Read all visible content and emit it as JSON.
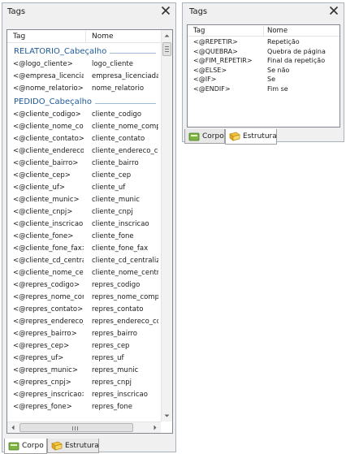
{
  "left_panel": {
    "title": "Tags",
    "columns": {
      "tag": "Tag",
      "nome": "Nome"
    },
    "groups": [
      {
        "label": "RELATORIO_Cabeçalho",
        "rows": [
          {
            "tag": "<@logo_cliente>",
            "nome": "logo_cliente"
          },
          {
            "tag": "<@empresa_licenciada>",
            "nome": "empresa_licenciada"
          },
          {
            "tag": "<@nome_relatorio>",
            "nome": "nome_relatorio"
          }
        ]
      },
      {
        "label": "PEDIDO_Cabeçalho",
        "rows": [
          {
            "tag": "<@cliente_codigo>",
            "nome": "cliente_codigo"
          },
          {
            "tag": "<@cliente_nome_completo>",
            "nome": "cliente_nome_completo"
          },
          {
            "tag": "<@cliente_contato>",
            "nome": "cliente_contato"
          },
          {
            "tag": "<@cliente_endereco_completo>",
            "nome": "cliente_endereco_completo"
          },
          {
            "tag": "<@cliente_bairro>",
            "nome": "cliente_bairro"
          },
          {
            "tag": "<@cliente_cep>",
            "nome": "cliente_cep"
          },
          {
            "tag": "<@cliente_uf>",
            "nome": "cliente_uf"
          },
          {
            "tag": "<@cliente_munic>",
            "nome": "cliente_munic"
          },
          {
            "tag": "<@cliente_cnpj>",
            "nome": "cliente_cnpj"
          },
          {
            "tag": "<@cliente_inscricao>",
            "nome": "cliente_inscricao"
          },
          {
            "tag": "<@cliente_fone>",
            "nome": "cliente_fone"
          },
          {
            "tag": "<@cliente_fone_fax>",
            "nome": "cliente_fone_fax"
          },
          {
            "tag": "<@cliente_cd_centralizador>",
            "nome": "cliente_cd_centralizador"
          },
          {
            "tag": "<@cliente_nome_centralizador>",
            "nome": "cliente_nome_centralizador"
          },
          {
            "tag": "<@repres_codigo>",
            "nome": "repres_codigo"
          },
          {
            "tag": "<@repres_nome_completo>",
            "nome": "repres_nome_completo"
          },
          {
            "tag": "<@repres_contato>",
            "nome": "repres_contato"
          },
          {
            "tag": "<@repres_endereco_completo>",
            "nome": "repres_endereco_completo"
          },
          {
            "tag": "<@repres_bairro>",
            "nome": "repres_bairro"
          },
          {
            "tag": "<@repres_cep>",
            "nome": "repres_cep"
          },
          {
            "tag": "<@repres_uf>",
            "nome": "repres_uf"
          },
          {
            "tag": "<@repres_munic>",
            "nome": "repres_munic"
          },
          {
            "tag": "<@repres_cnpj>",
            "nome": "repres_cnpj"
          },
          {
            "tag": "<@repres_inscricao>",
            "nome": "repres_inscricao"
          },
          {
            "tag": "<@repres_fone>",
            "nome": "repres_fone"
          }
        ]
      }
    ],
    "tabs": [
      {
        "label": "Corpo",
        "icon": "corpo-tab-icon"
      },
      {
        "label": "Estrutura",
        "icon": "estrutura-tab-icon"
      }
    ],
    "active_tab": "Corpo"
  },
  "right_panel": {
    "title": "Tags",
    "columns": {
      "tag": "Tag",
      "nome": "Nome"
    },
    "rows": [
      {
        "tag": "<@REPETIR>",
        "nome": "Repetição"
      },
      {
        "tag": "<@QUEBRA>",
        "nome": "Quebra de página"
      },
      {
        "tag": "<@FIM_REPETIR>",
        "nome": "Final da repetição"
      },
      {
        "tag": "<@ELSE>",
        "nome": "Se não"
      },
      {
        "tag": "<@IF>",
        "nome": "Se"
      },
      {
        "tag": "<@ENDIF>",
        "nome": "Fim se"
      }
    ],
    "tabs": [
      {
        "label": "Corpo",
        "icon": "corpo-tab-icon"
      },
      {
        "label": "Estrutura",
        "icon": "estrutura-tab-icon"
      }
    ],
    "active_tab": "Estrutura"
  },
  "colors": {
    "group_label": "#1e5a9a",
    "group_line": "#9ebbd8",
    "panel_bg": "#f0f0f0",
    "list_border": "#828790"
  }
}
